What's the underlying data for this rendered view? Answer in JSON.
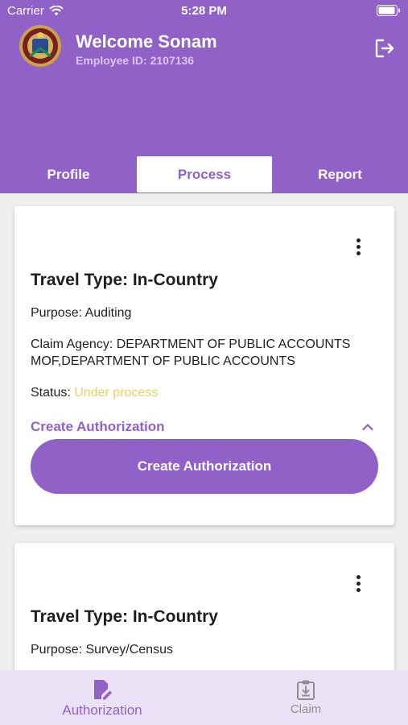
{
  "status_bar": {
    "carrier": "Carrier",
    "time": "5:28 PM"
  },
  "header": {
    "welcome": "Welcome Sonam",
    "employee_id": "Employee ID: 2107136",
    "logout_icon": "logout-icon",
    "logo": "emblem-logo"
  },
  "tabs": [
    {
      "label": "Profile",
      "active": false
    },
    {
      "label": "Process",
      "active": true
    },
    {
      "label": "Report",
      "active": false
    }
  ],
  "cards": [
    {
      "title": "Travel Type: In-Country",
      "purpose": "Purpose: Auditing",
      "claim_agency_line1": "Claim Agency: DEPARTMENT OF PUBLIC ACCOUNTS",
      "claim_agency_line2": "MOF,DEPARTMENT OF PUBLIC ACCOUNTS",
      "status_label": "Status: ",
      "status_value": "Under process",
      "auth_link": "Create Authorization",
      "auth_button": "Create Authorization"
    },
    {
      "title": "Travel Type: In-Country",
      "purpose": "Purpose: Survey/Census"
    }
  ],
  "bottom_nav": [
    {
      "label": "Authorization",
      "icon": "edit-document-icon",
      "active": true
    },
    {
      "label": "Claim",
      "icon": "clipboard-download-icon",
      "active": false
    }
  ],
  "colors": {
    "accent": "#9061c7",
    "status_pending": "#e8d35a",
    "nav_background": "#ece2f7"
  }
}
